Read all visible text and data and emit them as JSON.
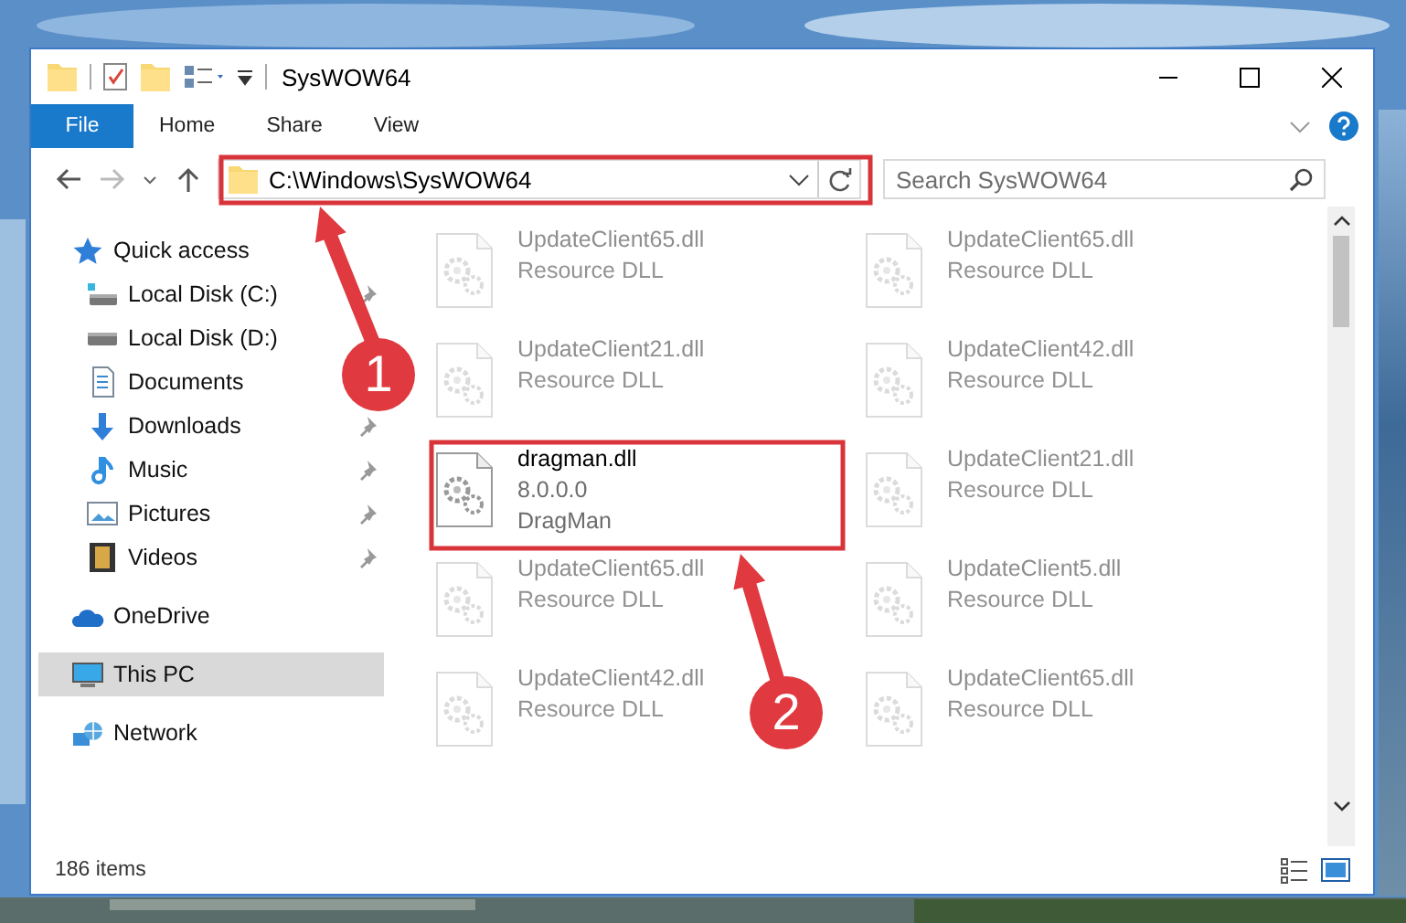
{
  "window": {
    "title": "SysWOW64"
  },
  "ribbon_tabs": [
    {
      "label": "File",
      "kind": "file"
    },
    {
      "label": "Home",
      "kind": "tab"
    },
    {
      "label": "Share",
      "kind": "tab"
    },
    {
      "label": "View",
      "kind": "tab"
    }
  ],
  "address_bar": {
    "path": "C:\\Windows\\SysWOW64"
  },
  "search": {
    "placeholder": "Search SysWOW64"
  },
  "nav_pane": {
    "items": [
      {
        "label": "Quick access",
        "kind": "star",
        "selected": false,
        "children": [
          {
            "label": "Local Disk (C:)",
            "kind": "drive-c",
            "pinned": true
          },
          {
            "label": "Local Disk (D:)",
            "kind": "drive"
          },
          {
            "label": "Documents",
            "kind": "documents"
          },
          {
            "label": "Downloads",
            "kind": "downloads",
            "pinned": true
          },
          {
            "label": "Music",
            "kind": "music",
            "pinned": true
          },
          {
            "label": "Pictures",
            "kind": "pictures",
            "pinned": true
          },
          {
            "label": "Videos",
            "kind": "videos",
            "pinned": true
          }
        ]
      },
      {
        "label": "OneDrive",
        "kind": "cloud",
        "selected": false
      },
      {
        "label": "This PC",
        "kind": "computer",
        "selected": true
      },
      {
        "label": "Network",
        "kind": "network",
        "selected": false
      }
    ]
  },
  "files": [
    {
      "name": "UpdateClient65.dll",
      "details": [
        "Resource DLL"
      ],
      "dimmed": true
    },
    {
      "name": "UpdateClient65.dll",
      "details": [
        "Resource DLL"
      ],
      "dimmed": true
    },
    {
      "name": "UpdateClient21.dll",
      "details": [
        "Resource DLL"
      ],
      "dimmed": true
    },
    {
      "name": "UpdateClient42.dll",
      "details": [
        "Resource DLL"
      ],
      "dimmed": true
    },
    {
      "name": "dragman.dll",
      "details": [
        "8.0.0.0",
        "DragMan"
      ],
      "dimmed": false
    },
    {
      "name": "UpdateClient21.dll",
      "details": [
        "Resource DLL"
      ],
      "dimmed": true
    },
    {
      "name": "UpdateClient65.dll",
      "details": [
        "Resource DLL"
      ],
      "dimmed": true
    },
    {
      "name": "UpdateClient5.dll",
      "details": [
        "Resource DLL"
      ],
      "dimmed": true
    },
    {
      "name": "UpdateClient42.dll",
      "details": [
        "Resource DLL"
      ],
      "dimmed": true
    },
    {
      "name": "UpdateClient65.dll",
      "details": [
        "Resource DLL"
      ],
      "dimmed": true
    }
  ],
  "status_bar": {
    "item_count": "186 items"
  },
  "annotations": [
    {
      "number": "1"
    },
    {
      "number": "2"
    }
  ]
}
